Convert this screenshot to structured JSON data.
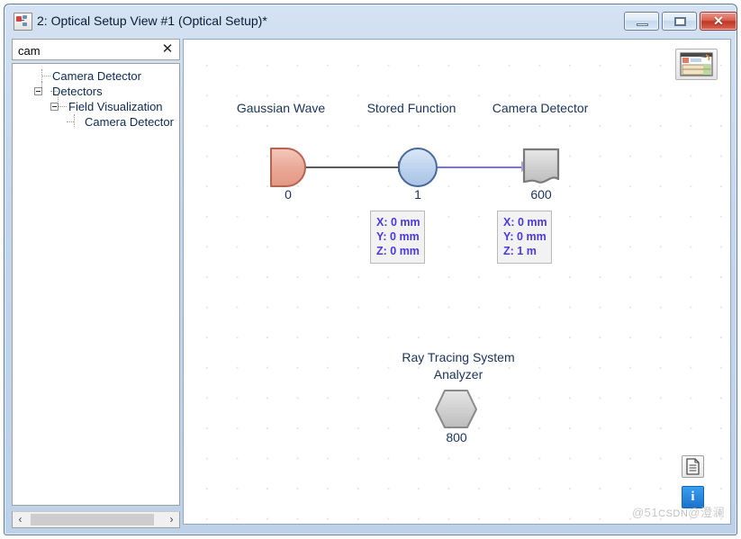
{
  "window": {
    "title": "2: Optical Setup View #1 (Optical Setup)*",
    "icon": "optical-setup-icon",
    "controls": {
      "minimize": "–",
      "maximize": "□",
      "close": "✕"
    }
  },
  "sidebar": {
    "search": {
      "value": "cam",
      "placeholder": "",
      "clear_label": "✕"
    },
    "tree": [
      {
        "label": "Camera Detector",
        "depth": 1,
        "expander": "none"
      },
      {
        "label": "Detectors",
        "depth": 1,
        "expander": "minus"
      },
      {
        "label": "Field Visualization",
        "depth": 2,
        "expander": "minus"
      },
      {
        "label": "Camera Detector",
        "depth": 3,
        "expander": "none"
      }
    ],
    "scrollbar": {
      "left_arrow": "‹",
      "right_arrow": "›"
    }
  },
  "canvas": {
    "nodes": [
      {
        "name": "Gaussian Wave",
        "number": "0",
        "shape": "d-shape",
        "color": "#e8a392"
      },
      {
        "name": "Stored Function",
        "number": "1",
        "shape": "ellipse",
        "color": "#bcd2ee"
      },
      {
        "name": "Camera Detector",
        "number": "600",
        "shape": "document",
        "color": "#c8c8c8"
      },
      {
        "name": "Ray Tracing System Analyzer",
        "number": "800",
        "shape": "hexagon",
        "color": "#c8c8c8"
      }
    ],
    "connectors": [
      {
        "from": "Gaussian Wave",
        "to": "Stored Function",
        "color": "#5a5a5a"
      },
      {
        "from": "Stored Function",
        "to": "Camera Detector",
        "color": "#7a72e8"
      }
    ],
    "tooltips": [
      {
        "for": "Stored Function",
        "lines": [
          "X: 0 mm",
          "Y: 0 mm",
          "Z: 0 mm"
        ]
      },
      {
        "for": "Camera Detector",
        "lines": [
          "X: 0 mm",
          "Y: 0 mm",
          "Z: 1 m"
        ]
      }
    ],
    "buttons": [
      {
        "name": "optical-setup-view-button",
        "icon": "optical-table-icon"
      },
      {
        "name": "document-button",
        "icon": "document-icon"
      },
      {
        "name": "info-button",
        "icon": "info-icon",
        "glyph": "i"
      }
    ],
    "watermark": {
      "part1": "@51",
      "part2": "CSDN",
      "part3": "@澄澜"
    }
  }
}
